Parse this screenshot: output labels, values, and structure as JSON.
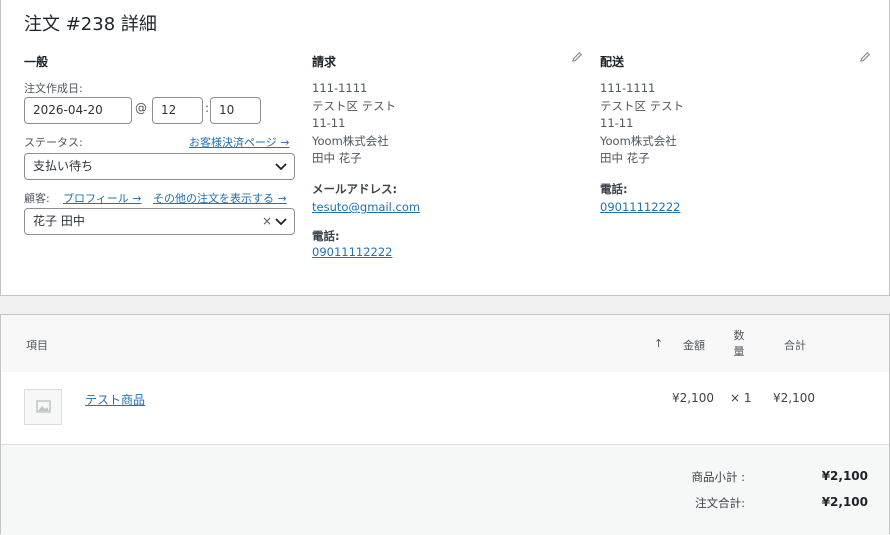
{
  "page": {
    "title": "注文 #238 詳細"
  },
  "general": {
    "heading": "一般",
    "date_label": "注文作成日:",
    "date_value": "2026-04-20",
    "at_symbol": "@",
    "hour_value": "12",
    "colon": ":",
    "minute_value": "10",
    "status_label": "ステータス:",
    "payment_page_link": "お客様決済ページ →",
    "status_value": "支払い待ち",
    "customer_label": "顧客:",
    "profile_link": "プロフィール →",
    "other_orders_link": "その他の注文を表示する →",
    "customer_value": "花子 田中",
    "clear_symbol": "×"
  },
  "billing": {
    "heading": "請求",
    "address_lines": [
      "111-1111",
      "テスト区 テスト",
      "11-11",
      "Yoom株式会社",
      "田中 花子"
    ],
    "email_label": "メールアドレス:",
    "email_value": "tesuto@gmail.com",
    "phone_label": "電話:",
    "phone_value": "09011112222"
  },
  "shipping": {
    "heading": "配送",
    "address_lines": [
      "111-1111",
      "テスト区 テスト",
      "11-11",
      "Yoom株式会社",
      "田中 花子"
    ],
    "phone_label": "電話:",
    "phone_value": "09011112222"
  },
  "items": {
    "col_item": "項目",
    "col_sort": "↑",
    "col_amount": "金額",
    "col_qty_1": "数",
    "col_qty_2": "量",
    "col_total": "合計",
    "rows": [
      {
        "name": "テスト商品",
        "price": "¥2,100",
        "qty": "× 1",
        "total": "¥2,100"
      }
    ]
  },
  "totals": {
    "subtotal_label": "商品小計 :",
    "subtotal_value": "¥2,100",
    "order_total_label": "注文合計:",
    "order_total_value": "¥2,100"
  },
  "icons": {
    "edit": "pencil-icon",
    "chevron": "chevron-down-icon",
    "image": "image-placeholder-icon"
  }
}
